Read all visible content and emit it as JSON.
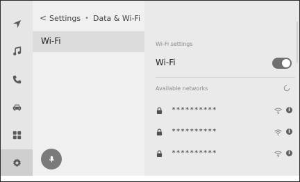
{
  "header": {
    "back_symbol": "<",
    "breadcrumb_parent": "Settings",
    "breadcrumb_separator": "•",
    "breadcrumb_current": "Data & Wi-Fi"
  },
  "left_menu": {
    "items": [
      {
        "label": "Wi-Fi"
      }
    ]
  },
  "rail": {
    "icons": [
      "navigation-icon",
      "music-icon",
      "phone-icon",
      "car-icon",
      "apps-icon",
      "settings-icon"
    ],
    "active": "settings-icon"
  },
  "right": {
    "wifi_settings_title": "Wi-Fi settings",
    "wifi_label": "Wi-Fi",
    "wifi_enabled": true,
    "available_title": "Available networks",
    "networks": [
      {
        "name": "**********",
        "secured": true
      },
      {
        "name": "**********",
        "secured": true
      },
      {
        "name": "**********",
        "secured": true
      }
    ]
  },
  "colors": {
    "rail_bg": "#e6e6e6",
    "left_bg": "#f0f0f0",
    "right_bg": "#eaeaea",
    "toggle_on": "#6f6f6f"
  }
}
